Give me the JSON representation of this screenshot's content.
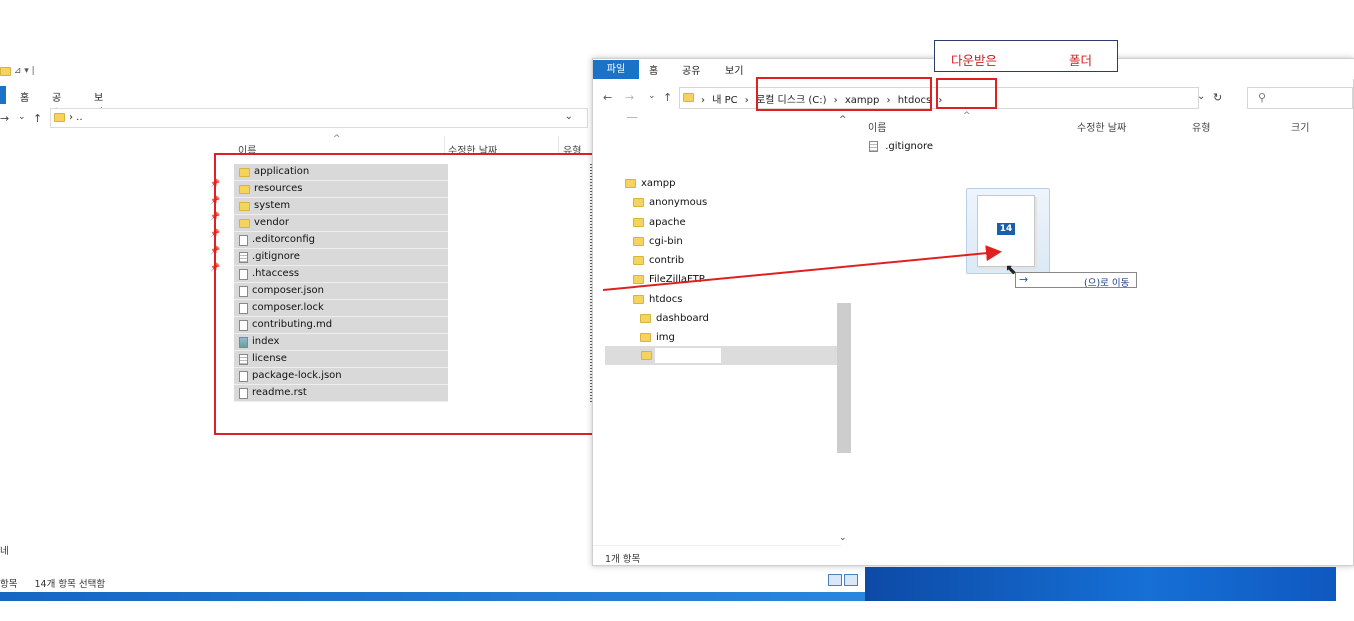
{
  "left_window": {
    "quick_access": "⊿ ▾ |",
    "ribbon_tabs": [
      "홈",
      "공유",
      "보기"
    ],
    "address": "› ..",
    "columns": {
      "name": "이름",
      "modified": "수정한 날짜",
      "type": "유형"
    },
    "files": [
      {
        "name": "application",
        "kind": "folder"
      },
      {
        "name": "resources",
        "kind": "folder"
      },
      {
        "name": "system",
        "kind": "folder"
      },
      {
        "name": "vendor",
        "kind": "folder"
      },
      {
        "name": ".editorconfig",
        "kind": "file"
      },
      {
        "name": ".gitignore",
        "kind": "text"
      },
      {
        "name": ".htaccess",
        "kind": "file"
      },
      {
        "name": "composer.json",
        "kind": "file"
      },
      {
        "name": "composer.lock",
        "kind": "file"
      },
      {
        "name": "contributing.md",
        "kind": "file"
      },
      {
        "name": "index",
        "kind": "image"
      },
      {
        "name": "license",
        "kind": "text"
      },
      {
        "name": "package-lock.json",
        "kind": "file"
      },
      {
        "name": "readme.rst",
        "kind": "file"
      }
    ],
    "status_items": "항목",
    "status_selected": "14개 항목 선택함",
    "nav_label": "네"
  },
  "right_window": {
    "file_tab": "파일",
    "ribbon_tabs": [
      "홈",
      "공유",
      "보기"
    ],
    "breadcrumb": [
      "내 PC",
      "로컬 디스크 (C:)",
      "xampp",
      "htdocs"
    ],
    "tree": [
      {
        "name": "xampp",
        "indent": 0
      },
      {
        "name": "anonymous",
        "indent": 1
      },
      {
        "name": "apache",
        "indent": 1
      },
      {
        "name": "cgi-bin",
        "indent": 1
      },
      {
        "name": "contrib",
        "indent": 1
      },
      {
        "name": "FileZillaFTP",
        "indent": 1
      },
      {
        "name": "htdocs",
        "indent": 1
      },
      {
        "name": "dashboard",
        "indent": 2
      },
      {
        "name": "img",
        "indent": 2
      }
    ],
    "columns": {
      "name": "이름",
      "modified": "수정한 날짜",
      "type": "유형",
      "size": "크기"
    },
    "files": [
      ".gitignore"
    ],
    "status": "1개 항목"
  },
  "drag": {
    "count": "14",
    "move_tooltip": "(으)로 이동"
  },
  "annotation": {
    "part1": "다운받은",
    "part2": "폴더",
    "color": "#d21e1e"
  }
}
